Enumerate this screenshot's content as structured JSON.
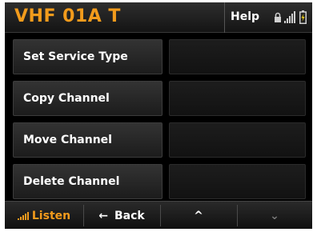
{
  "header": {
    "title": "VHF 01A T",
    "help_label": "Help",
    "icons": [
      "lock-icon",
      "signal-icon",
      "battery-icon"
    ]
  },
  "menu": {
    "items": [
      {
        "label": "Set Service Type",
        "value": ""
      },
      {
        "label": "Copy Channel",
        "value": ""
      },
      {
        "label": "Move Channel",
        "value": ""
      },
      {
        "label": "Delete Channel",
        "value": ""
      }
    ]
  },
  "softkeys": {
    "listen": "Listen",
    "back": "Back",
    "back_glyph": "←",
    "up_glyph": "^",
    "down_glyph": "⌄"
  },
  "colors": {
    "accent": "#f29b1c",
    "background": "#000000",
    "text": "#ffffff",
    "disabled": "#777777"
  }
}
